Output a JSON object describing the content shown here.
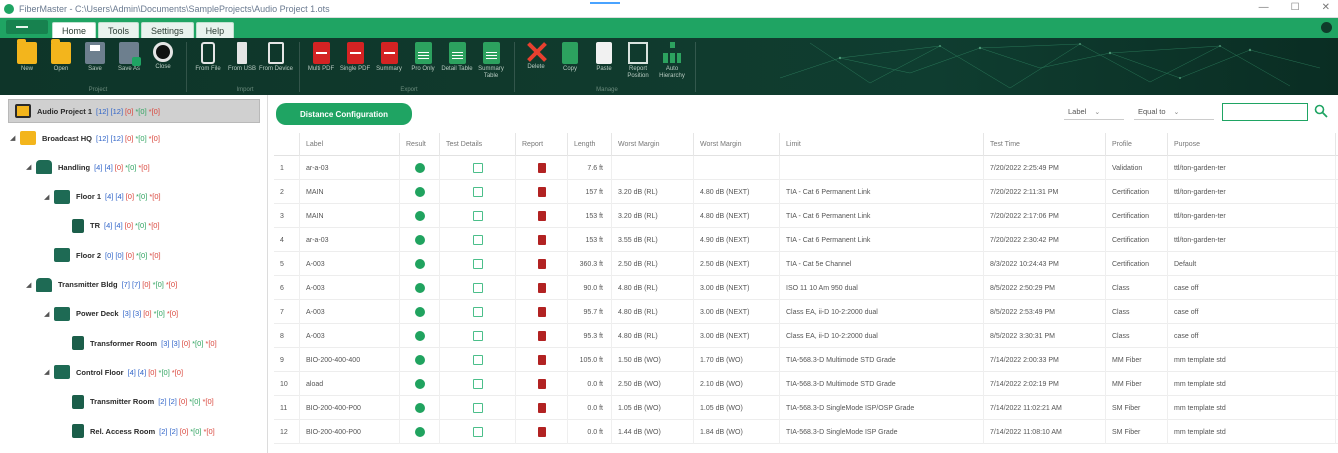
{
  "window": {
    "title": "FiberMaster - C:\\Users\\Admin\\Documents\\SampleProjects\\Audio Project 1.ots"
  },
  "menu": {
    "tabs": [
      "Home",
      "Tools",
      "Settings",
      "Help"
    ],
    "active": 0
  },
  "ribbon": {
    "groups": [
      {
        "label": "Project",
        "buttons": [
          {
            "label": "New",
            "icon": "folder-new-icon"
          },
          {
            "label": "Open",
            "icon": "folder-open-icon"
          },
          {
            "label": "Save",
            "icon": "save-icon"
          },
          {
            "label": "Save As",
            "icon": "save-as-icon"
          },
          {
            "label": "Close",
            "icon": "close-project-icon"
          }
        ]
      },
      {
        "label": "Import",
        "buttons": [
          {
            "label": "From File",
            "icon": "phone-import-icon"
          },
          {
            "label": "From USB",
            "icon": "usb-icon"
          },
          {
            "label": "From Device",
            "icon": "device-icon"
          }
        ]
      },
      {
        "label": "Export",
        "buttons": [
          {
            "label": "Multi PDF",
            "icon": "pdf-multi-icon"
          },
          {
            "label": "Single PDF",
            "icon": "pdf-single-icon"
          },
          {
            "label": "Summary",
            "icon": "pdf-summary-icon"
          },
          {
            "label": "Pro Only",
            "icon": "xls-pro-icon"
          },
          {
            "label": "Detail Table",
            "icon": "xls-detail-icon"
          },
          {
            "label": "Summary Table",
            "icon": "xls-summary-icon"
          }
        ]
      },
      {
        "label": "Manage",
        "buttons": [
          {
            "label": "Delete",
            "icon": "delete-icon"
          },
          {
            "label": "Copy",
            "icon": "copy-icon"
          },
          {
            "label": "Paste",
            "icon": "paste-icon"
          },
          {
            "label": "Report Position",
            "icon": "report-icon"
          },
          {
            "label": "Auto Hierarchy",
            "icon": "hierarchy-icon"
          }
        ]
      }
    ]
  },
  "tree": [
    {
      "name": "Audio Project 1",
      "level": 0,
      "icon": "project",
      "chev": "",
      "counts": [
        "[12]",
        "[12]",
        "[0]",
        "*[0]",
        "*[0]"
      ]
    },
    {
      "name": "Broadcast HQ",
      "level": 1,
      "icon": "building",
      "chev": "◢",
      "counts": [
        "[12]",
        "[12]",
        "[0]",
        "*[0]",
        "*[0]"
      ]
    },
    {
      "name": "Handling",
      "level": 2,
      "icon": "building-g",
      "chev": "◢",
      "counts": [
        "[4]",
        "[4]",
        "[0]",
        "*[0]",
        "*[0]"
      ]
    },
    {
      "name": "Floor 1",
      "level": 3,
      "icon": "floor",
      "chev": "◢",
      "counts": [
        "[4]",
        "[4]",
        "[0]",
        "*[0]",
        "*[0]"
      ]
    },
    {
      "name": "TR",
      "level": 4,
      "icon": "room",
      "chev": "",
      "counts": [
        "[4]",
        "[4]",
        "[0]",
        "*[0]",
        "*[0]"
      ]
    },
    {
      "name": "Floor 2",
      "level": 3,
      "icon": "floor",
      "chev": "",
      "counts": [
        "[0]",
        "[0]",
        "[0]",
        "*[0]",
        "*[0]"
      ]
    },
    {
      "name": "Transmitter Bldg",
      "level": 2,
      "icon": "building-g",
      "chev": "◢",
      "counts": [
        "[7]",
        "[7]",
        "[0]",
        "*[0]",
        "*[0]"
      ]
    },
    {
      "name": "Power Deck",
      "level": 3,
      "icon": "floor",
      "chev": "◢",
      "counts": [
        "[3]",
        "[3]",
        "[0]",
        "*[0]",
        "*[0]"
      ]
    },
    {
      "name": "Transformer Room",
      "level": 4,
      "icon": "room",
      "chev": "",
      "counts": [
        "[3]",
        "[3]",
        "[0]",
        "*[0]",
        "*[0]"
      ]
    },
    {
      "name": "Control Floor",
      "level": 3,
      "icon": "floor",
      "chev": "◢",
      "counts": [
        "[4]",
        "[4]",
        "[0]",
        "*[0]",
        "*[0]"
      ]
    },
    {
      "name": "Transmitter Room",
      "level": 4,
      "icon": "room",
      "chev": "",
      "counts": [
        "[2]",
        "[2]",
        "[0]",
        "*[0]",
        "*[0]"
      ]
    },
    {
      "name": "Rel. Access Room",
      "level": 4,
      "icon": "room",
      "chev": "",
      "counts": [
        "[2]",
        "[2]",
        "[0]",
        "*[0]",
        "*[0]"
      ]
    }
  ],
  "toolbar": {
    "distance_button": "Distance Configuration",
    "filter_field": "Label",
    "filter_op": "Equal to",
    "search_placeholder": ""
  },
  "table": {
    "columns": [
      "",
      "Label",
      "Result",
      "Test Details",
      "Report",
      "Length",
      "Worst Margin",
      "Worst Margin",
      "Limit",
      "Test Time",
      "Profile",
      "Purpose"
    ],
    "rows": [
      {
        "n": "1",
        "label": "ar-a-03",
        "length": "7.6 ft",
        "m1": "",
        "m2": "",
        "limit": "",
        "time": "7/20/2022 2:25:49 PM",
        "profile": "Validation",
        "purpose": "ttl/ton-garden-ter"
      },
      {
        "n": "2",
        "label": "MAIN",
        "length": "157 ft",
        "m1": "3.20 dB (RL)",
        "m2": "4.80 dB (NEXT)",
        "limit": "TIA - Cat 6 Permanent Link",
        "time": "7/20/2022 2:11:31 PM",
        "profile": "Certification",
        "purpose": "ttl/ton-garden-ter"
      },
      {
        "n": "3",
        "label": "MAIN",
        "length": "153 ft",
        "m1": "3.20 dB (RL)",
        "m2": "4.80 dB (NEXT)",
        "limit": "TIA - Cat 6 Permanent Link",
        "time": "7/20/2022 2:17:06 PM",
        "profile": "Certification",
        "purpose": "ttl/ton-garden-ter"
      },
      {
        "n": "4",
        "label": "ar-a-03",
        "length": "153 ft",
        "m1": "3.55 dB (RL)",
        "m2": "4.90 dB (NEXT)",
        "limit": "TIA - Cat 6 Permanent Link",
        "time": "7/20/2022 2:30:42 PM",
        "profile": "Certification",
        "purpose": "ttl/ton-garden-ter"
      },
      {
        "n": "5",
        "label": "A-003",
        "length": "360.3 ft",
        "m1": "2.50 dB (RL)",
        "m2": "2.50 dB (NEXT)",
        "limit": "TIA - Cat 5e Channel",
        "time": "8/3/2022 10:24:43 PM",
        "profile": "Certification",
        "purpose": "Default"
      },
      {
        "n": "6",
        "label": "A-003",
        "length": "90.0 ft",
        "m1": "4.80 dB (RL)",
        "m2": "3.00 dB (NEXT)",
        "limit": "ISO 11 10 Am 950 dual",
        "time": "8/5/2022 2:50:29 PM",
        "profile": "Class",
        "purpose": "case off"
      },
      {
        "n": "7",
        "label": "A-003",
        "length": "95.7 ft",
        "m1": "4.80 dB (RL)",
        "m2": "3.00 dB (NEXT)",
        "limit": "Class EA, ii-D 10-2:2000 dual",
        "time": "8/5/2022 2:53:49 PM",
        "profile": "Class",
        "purpose": "case off"
      },
      {
        "n": "8",
        "label": "A-003",
        "length": "95.3 ft",
        "m1": "4.80 dB (RL)",
        "m2": "3.00 dB (NEXT)",
        "limit": "Class EA, ii-D 10-2:2000 dual",
        "time": "8/5/2022 3:30:31 PM",
        "profile": "Class",
        "purpose": "case off"
      },
      {
        "n": "9",
        "label": "BIO-200-400-400",
        "length": "105.0 ft",
        "m1": "1.50 dB (WO)",
        "m2": "1.70 dB (WO)",
        "limit": "TIA-568.3-D Multimode STD Grade",
        "time": "7/14/2022 2:00:33 PM",
        "profile": "MM Fiber",
        "purpose": "mm template std"
      },
      {
        "n": "10",
        "label": "aload",
        "length": "0.0 ft",
        "m1": "2.50 dB (WO)",
        "m2": "2.10 dB (WO)",
        "limit": "TIA-568.3-D Multimode STD Grade",
        "time": "7/14/2022 2:02:19 PM",
        "profile": "MM Fiber",
        "purpose": "mm template std"
      },
      {
        "n": "11",
        "label": "BIO-200-400-P00",
        "length": "0.0 ft",
        "m1": "1.05 dB (WO)",
        "m2": "1.05 dB (WO)",
        "limit": "TIA-568.3-D SingleMode ISP/OSP Grade",
        "time": "7/14/2022 11:02:21 AM",
        "profile": "SM Fiber",
        "purpose": "mm template std"
      },
      {
        "n": "12",
        "label": "BIO-200-400-P00",
        "length": "0.0 ft",
        "m1": "1.44 dB (WO)",
        "m2": "1.84 dB (WO)",
        "limit": "TIA-568.3-D SingleMode ISP Grade",
        "time": "7/14/2022 11:08:10 AM",
        "profile": "SM Fiber",
        "purpose": "mm template std"
      }
    ]
  },
  "colors": {
    "accent": "#1fa463",
    "ribbon_bg": "#0f3a2d"
  }
}
